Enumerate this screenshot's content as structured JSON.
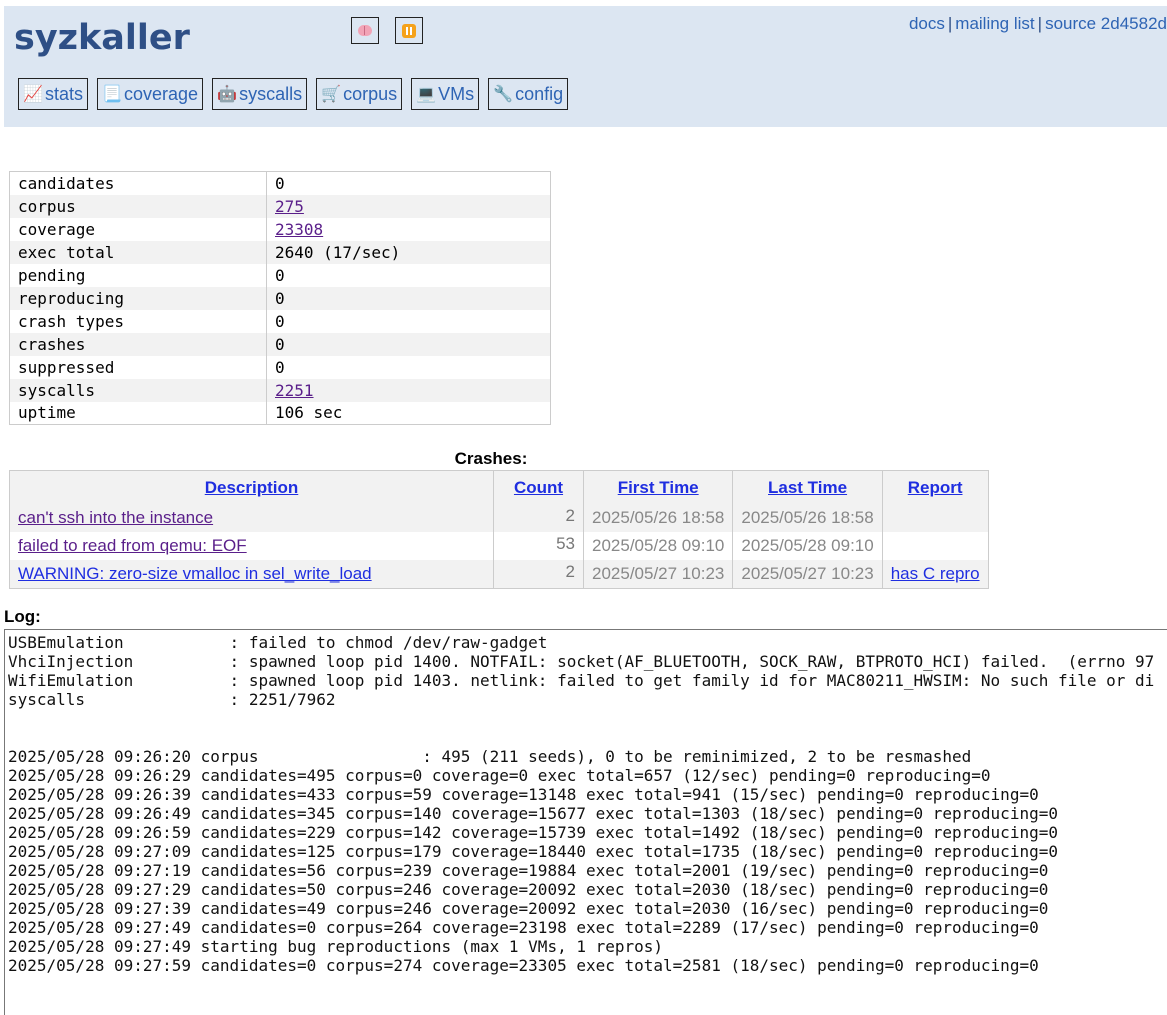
{
  "header": {
    "logo": "syzkaller",
    "links": [
      {
        "label": "docs"
      },
      {
        "label": "mailing list"
      },
      {
        "label": "source 2d4582d"
      }
    ],
    "separator": "|",
    "nav": [
      {
        "icon": "📈",
        "label": "stats"
      },
      {
        "icon": "📃",
        "label": "coverage"
      },
      {
        "icon": "🤖",
        "label": "syscalls"
      },
      {
        "icon": "🛒",
        "label": "corpus"
      },
      {
        "icon": "💻",
        "label": "VMs"
      },
      {
        "icon": "🔧",
        "label": "config"
      }
    ]
  },
  "stats": [
    {
      "key": "candidates",
      "value": "0"
    },
    {
      "key": "corpus",
      "value": "275",
      "link": true
    },
    {
      "key": "coverage",
      "value": "23308",
      "link": true
    },
    {
      "key": "exec total",
      "value": "2640 (17/sec)"
    },
    {
      "key": "pending",
      "value": "0"
    },
    {
      "key": "reproducing",
      "value": "0"
    },
    {
      "key": "crash types",
      "value": "0"
    },
    {
      "key": "crashes",
      "value": "0"
    },
    {
      "key": "suppressed",
      "value": "0"
    },
    {
      "key": "syscalls",
      "value": "2251",
      "link": true
    },
    {
      "key": "uptime",
      "value": "106 sec"
    }
  ],
  "crashes": {
    "title": "Crashes:",
    "columns": [
      "Description",
      "Count",
      "First Time",
      "Last Time",
      "Report"
    ],
    "rows": [
      {
        "description": "can't ssh into the instance",
        "count": "2",
        "first": "2025/05/26 18:58",
        "last": "2025/05/26 18:58",
        "report": "",
        "visited": true
      },
      {
        "description": "failed to read from qemu: EOF",
        "count": "53",
        "first": "2025/05/28 09:10",
        "last": "2025/05/28 09:10",
        "report": "",
        "visited": true
      },
      {
        "description": "WARNING: zero-size vmalloc in sel_write_load",
        "count": "2",
        "first": "2025/05/27 10:23",
        "last": "2025/05/27 10:23",
        "report": "has C repro",
        "visited": false
      }
    ]
  },
  "log": {
    "title": "Log:",
    "lines": [
      "USBEmulation           : failed to chmod /dev/raw-gadget",
      "VhciInjection          : spawned loop pid 1400. NOTFAIL: socket(AF_BLUETOOTH, SOCK_RAW, BTPROTO_HCI) failed.  (errno 97",
      "WifiEmulation          : spawned loop pid 1403. netlink: failed to get family id for MAC80211_HWSIM: No such file or di",
      "syscalls               : 2251/7962",
      "",
      "",
      "2025/05/28 09:26:20 corpus                 : 495 (211 seeds), 0 to be reminimized, 2 to be resmashed",
      "2025/05/28 09:26:29 candidates=495 corpus=0 coverage=0 exec total=657 (12/sec) pending=0 reproducing=0",
      "2025/05/28 09:26:39 candidates=433 corpus=59 coverage=13148 exec total=941 (15/sec) pending=0 reproducing=0",
      "2025/05/28 09:26:49 candidates=345 corpus=140 coverage=15677 exec total=1303 (18/sec) pending=0 reproducing=0",
      "2025/05/28 09:26:59 candidates=229 corpus=142 coverage=15739 exec total=1492 (18/sec) pending=0 reproducing=0",
      "2025/05/28 09:27:09 candidates=125 corpus=179 coverage=18440 exec total=1735 (18/sec) pending=0 reproducing=0",
      "2025/05/28 09:27:19 candidates=56 corpus=239 coverage=19884 exec total=2001 (19/sec) pending=0 reproducing=0",
      "2025/05/28 09:27:29 candidates=50 corpus=246 coverage=20092 exec total=2030 (18/sec) pending=0 reproducing=0",
      "2025/05/28 09:27:39 candidates=49 corpus=246 coverage=20092 exec total=2030 (16/sec) pending=0 reproducing=0",
      "2025/05/28 09:27:49 candidates=0 corpus=264 coverage=23198 exec total=2289 (17/sec) pending=0 reproducing=0",
      "2025/05/28 09:27:49 starting bug reproductions (max 1 VMs, 1 repros)",
      "2025/05/28 09:27:59 candidates=0 corpus=274 coverage=23305 exec total=2581 (18/sec) pending=0 reproducing=0"
    ]
  }
}
